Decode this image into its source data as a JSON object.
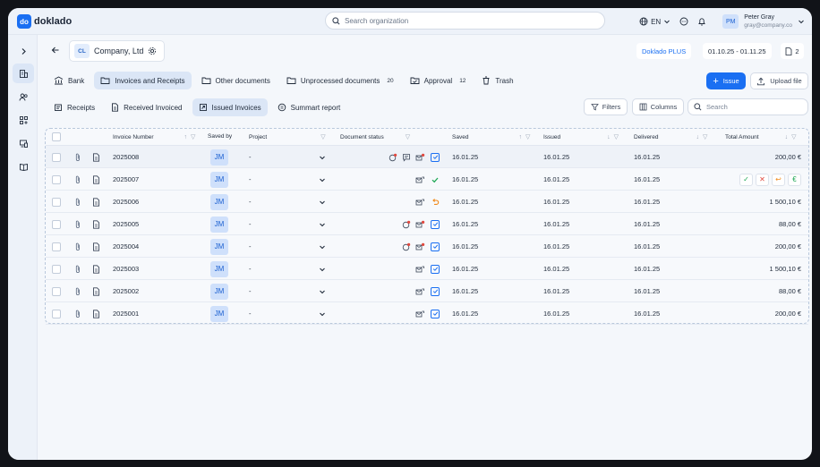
{
  "app": {
    "logo_badge": "do",
    "logo_text": "doklado"
  },
  "topbar": {
    "search_placeholder": "Search organization",
    "language": "EN",
    "user_initials": "PM",
    "user_name": "Peter Gray",
    "user_email": "gray@company.co"
  },
  "company": {
    "initials": "CL",
    "name": "Company, Ltd"
  },
  "plan": {
    "label": "Doklado PLUS",
    "period": "01.10.25 - 01.11.25",
    "doc_count": "2"
  },
  "tabs": [
    {
      "label": "Bank",
      "count": ""
    },
    {
      "label": "Invoices and Receipts",
      "count": ""
    },
    {
      "label": "Other documents",
      "count": ""
    },
    {
      "label": "Unprocessed documents",
      "count": "20"
    },
    {
      "label": "Approval",
      "count": "12"
    },
    {
      "label": "Trash",
      "count": ""
    }
  ],
  "actions": {
    "issue": "Issue",
    "upload": "Upload file"
  },
  "subtabs": [
    "Receipts",
    "Received Invoiced",
    "Issued Invoices",
    "Summart report"
  ],
  "toolbar": {
    "filters": "Filters",
    "columns": "Columns",
    "search_placeholder": "Search"
  },
  "columns": {
    "invoice": "Invoice Number",
    "saved_by": "Saved by",
    "project": "Project",
    "doc_status": "Document status",
    "saved": "Saved",
    "issued": "Issued",
    "delivered": "Delivered",
    "total": "Total Amount"
  },
  "rows": [
    {
      "invoice": "2025008",
      "saved_by": "JM",
      "project": "-",
      "saved": "16.01.25",
      "issued": "16.01.25",
      "delivered": "16.01.25",
      "total": "200,00 €"
    },
    {
      "invoice": "2025007",
      "saved_by": "JM",
      "project": "-",
      "saved": "16.01.25",
      "issued": "16.01.25",
      "delivered": "16.01.25",
      "total": ""
    },
    {
      "invoice": "2025006",
      "saved_by": "JM",
      "project": "-",
      "saved": "16.01.25",
      "issued": "16.01.25",
      "delivered": "16.01.25",
      "total": "1 500,10 €"
    },
    {
      "invoice": "2025005",
      "saved_by": "JM",
      "project": "-",
      "saved": "16.01.25",
      "issued": "16.01.25",
      "delivered": "16.01.25",
      "total": "88,00 €"
    },
    {
      "invoice": "2025004",
      "saved_by": "JM",
      "project": "-",
      "saved": "16.01.25",
      "issued": "16.01.25",
      "delivered": "16.01.25",
      "total": "200,00 €"
    },
    {
      "invoice": "2025003",
      "saved_by": "JM",
      "project": "-",
      "saved": "16.01.25",
      "issued": "16.01.25",
      "delivered": "16.01.25",
      "total": "1 500,10 €"
    },
    {
      "invoice": "2025002",
      "saved_by": "JM",
      "project": "-",
      "saved": "16.01.25",
      "issued": "16.01.25",
      "delivered": "16.01.25",
      "total": "88,00 €"
    },
    {
      "invoice": "2025001",
      "saved_by": "JM",
      "project": "-",
      "saved": "16.01.25",
      "issued": "16.01.25",
      "delivered": "16.01.25",
      "total": "200,00 €"
    }
  ],
  "row_actions": {
    "approve": "✓",
    "reject": "✕",
    "return": "↩",
    "pay": "€"
  },
  "colors": {
    "accent": "#1a6ff2",
    "approve": "#1fa855",
    "reject": "#e0493f",
    "return": "#f08a1c"
  }
}
